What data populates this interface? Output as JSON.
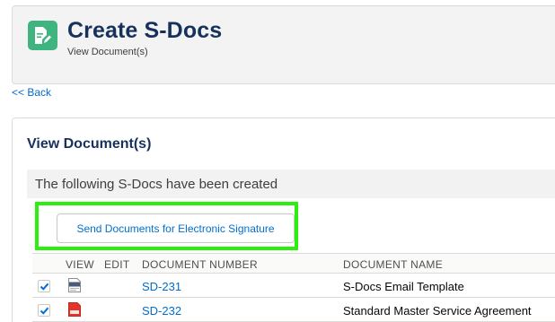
{
  "header": {
    "title": "Create S-Docs",
    "subtitle": "View Document(s)",
    "icon": "document-edit-icon",
    "icon_color": "#3fb47f"
  },
  "back_link": "<< Back",
  "panel": {
    "title": "View Document(s)",
    "created_message": "The following S-Docs have been created",
    "send_button": "Send Documents for Electronic Signature",
    "highlight_color": "#2cef10"
  },
  "table": {
    "columns": [
      "VIEW",
      "EDIT",
      "DOCUMENT NUMBER",
      "DOCUMENT NAME"
    ],
    "rows": [
      {
        "checked": true,
        "file_type": "html",
        "file_icon": "html-file-icon",
        "number": "SD-231",
        "name": "S-Docs Email Template"
      },
      {
        "checked": true,
        "file_type": "pdf",
        "file_icon": "pdf-file-icon",
        "number": "SD-232",
        "name": "Standard Master Service Agreement"
      }
    ]
  }
}
